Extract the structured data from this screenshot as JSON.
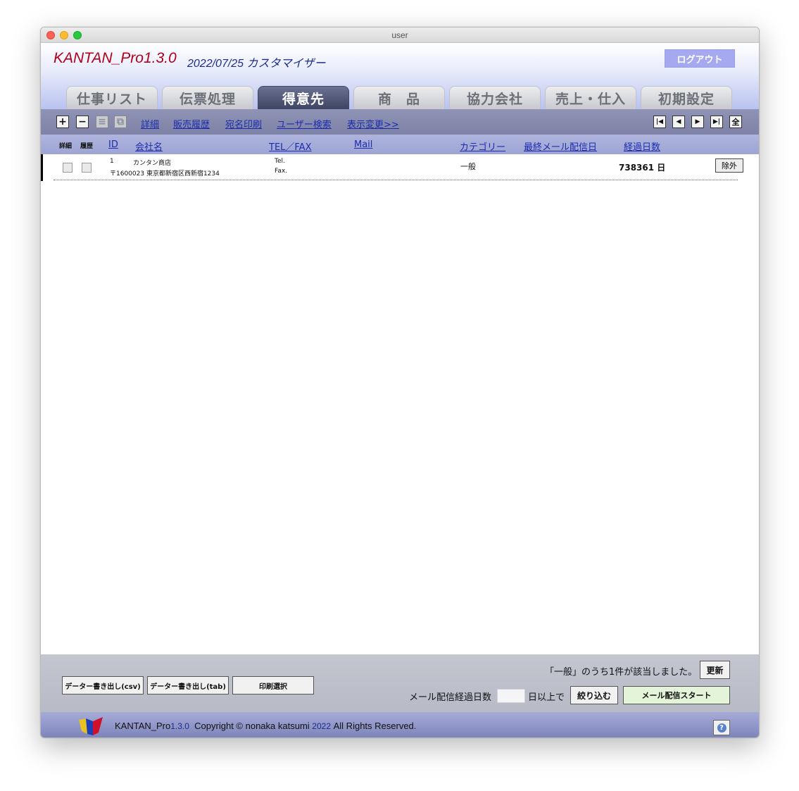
{
  "window": {
    "title": "user"
  },
  "header": {
    "app_title": "KANTAN_Pro1.3.0",
    "date_text": "2022/07/25 カスタマイザー",
    "logout": "ログアウト"
  },
  "tabs": [
    {
      "label": "仕事リスト"
    },
    {
      "label": "伝票処理"
    },
    {
      "label": "得意先",
      "active": true
    },
    {
      "label": "商　品"
    },
    {
      "label": "協力会社"
    },
    {
      "label": "売上・仕入"
    },
    {
      "label": "初期設定"
    }
  ],
  "toolbar": {
    "buttons": {
      "add": "+",
      "remove": "−",
      "list": "≡",
      "copy": "⧉"
    },
    "links": [
      "詳細",
      "販売履歴",
      "宛名印刷",
      "ユーザー検索",
      "表示変更>>"
    ],
    "nav": {
      "first": "|◀",
      "prev": "◀",
      "next": "▶",
      "last": "▶|",
      "all": "全"
    }
  },
  "columns": {
    "detail": "詳細",
    "history": "履歴",
    "id": "ID",
    "company": "会社名",
    "telfax": "TEL／FAX",
    "mail": "Mail",
    "category": "カテゴリー",
    "last_mail": "最終メール配信日",
    "days": "経過日数"
  },
  "rows": [
    {
      "id": "1",
      "company": "カンタン商店",
      "address": "〒1600023 東京都新宿区西新宿1234",
      "tel": "Tel.",
      "fax": "Fax.",
      "category": "一般",
      "days": "738361 日",
      "exclude": "除外"
    }
  ],
  "footer": {
    "export_csv": "データー書き出し(csv)",
    "export_tab": "データー書き出し(tab)",
    "print_select": "印刷選択",
    "result_text": "「一般」のうち1件が該当しました。",
    "refresh": "更新",
    "mail_days_label": "メール配信経過日数",
    "days_suffix": "日以上で",
    "filter": "絞り込む",
    "mail_start": "メール配信スタート"
  },
  "copyright": {
    "app": "KANTAN_Pro",
    "version": "1.3.0",
    "text1": "Copyright © nonaka katsumi",
    "year": "2022",
    "text2": "All Rights Reserved."
  },
  "colors": {
    "title_red": "#b3001a",
    "title_blue": "#1c2c8c",
    "link_blue": "#1d2bb0",
    "logout_bg": "#a7a9f0",
    "active_tab": "#4a5170"
  },
  "icons": {
    "help": "?"
  }
}
